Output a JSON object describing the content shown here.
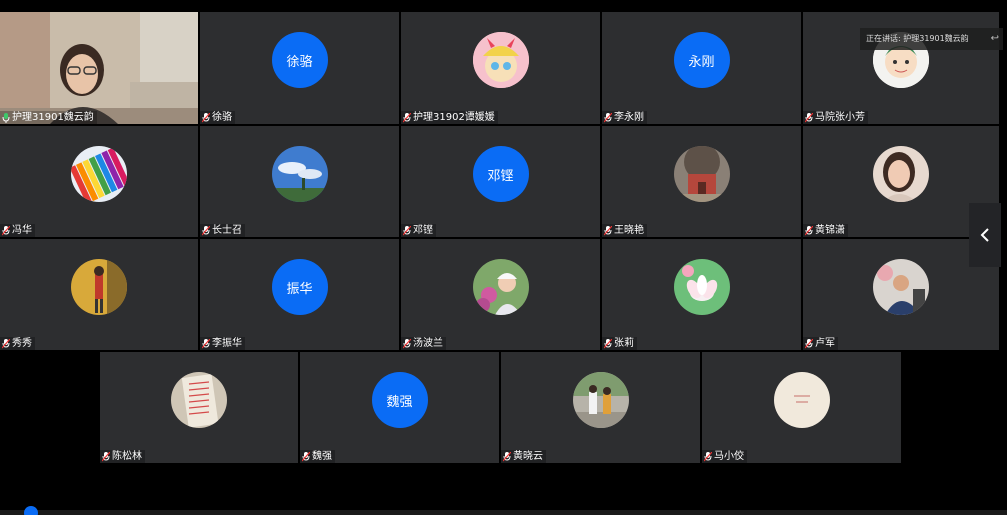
{
  "speaking": {
    "text": "正在讲话: 护理31901魏云韵"
  },
  "colors": {
    "tile_bg": "#2d2e30",
    "avatar_blue": "#0a6cf5",
    "background": "#000000"
  },
  "participants": [
    {
      "name": "护理31901魏云韵",
      "avatar_type": "video",
      "mic": "green-mic-icon"
    },
    {
      "name": "徐骆",
      "avatar_type": "initials",
      "initials": "徐骆"
    },
    {
      "name": "护理31902谭媛媛",
      "avatar_type": "image",
      "image": "cartoon-girl"
    },
    {
      "name": "李永刚",
      "avatar_type": "initials",
      "initials": "永刚"
    },
    {
      "name": "马院张小芳",
      "avatar_type": "image",
      "image": "cartoon-character"
    },
    {
      "name": "冯华",
      "avatar_type": "image",
      "image": "rainbow-crayons"
    },
    {
      "name": "长士召",
      "avatar_type": "image",
      "image": "sky-landscape"
    },
    {
      "name": "邓铿",
      "avatar_type": "initials",
      "initials": "邓铿"
    },
    {
      "name": "王晓艳",
      "avatar_type": "image",
      "image": "house-tree"
    },
    {
      "name": "黄锦潇",
      "avatar_type": "image",
      "image": "woman-portrait"
    },
    {
      "name": "秀秀",
      "avatar_type": "image",
      "image": "person-yellow-room"
    },
    {
      "name": "李振华",
      "avatar_type": "initials",
      "initials": "振华"
    },
    {
      "name": "汤波兰",
      "avatar_type": "image",
      "image": "woman-flowers"
    },
    {
      "name": "张莉",
      "avatar_type": "image",
      "image": "lotus-flower"
    },
    {
      "name": "卢军",
      "avatar_type": "image",
      "image": "man-outdoors"
    },
    {
      "name": "陈松林",
      "avatar_type": "image",
      "image": "handwritten-paper"
    },
    {
      "name": "魏强",
      "avatar_type": "initials",
      "initials": "魏强"
    },
    {
      "name": "黄晓云",
      "avatar_type": "image",
      "image": "street-people"
    },
    {
      "name": "马小佼",
      "avatar_type": "image",
      "image": "cream-card"
    }
  ]
}
